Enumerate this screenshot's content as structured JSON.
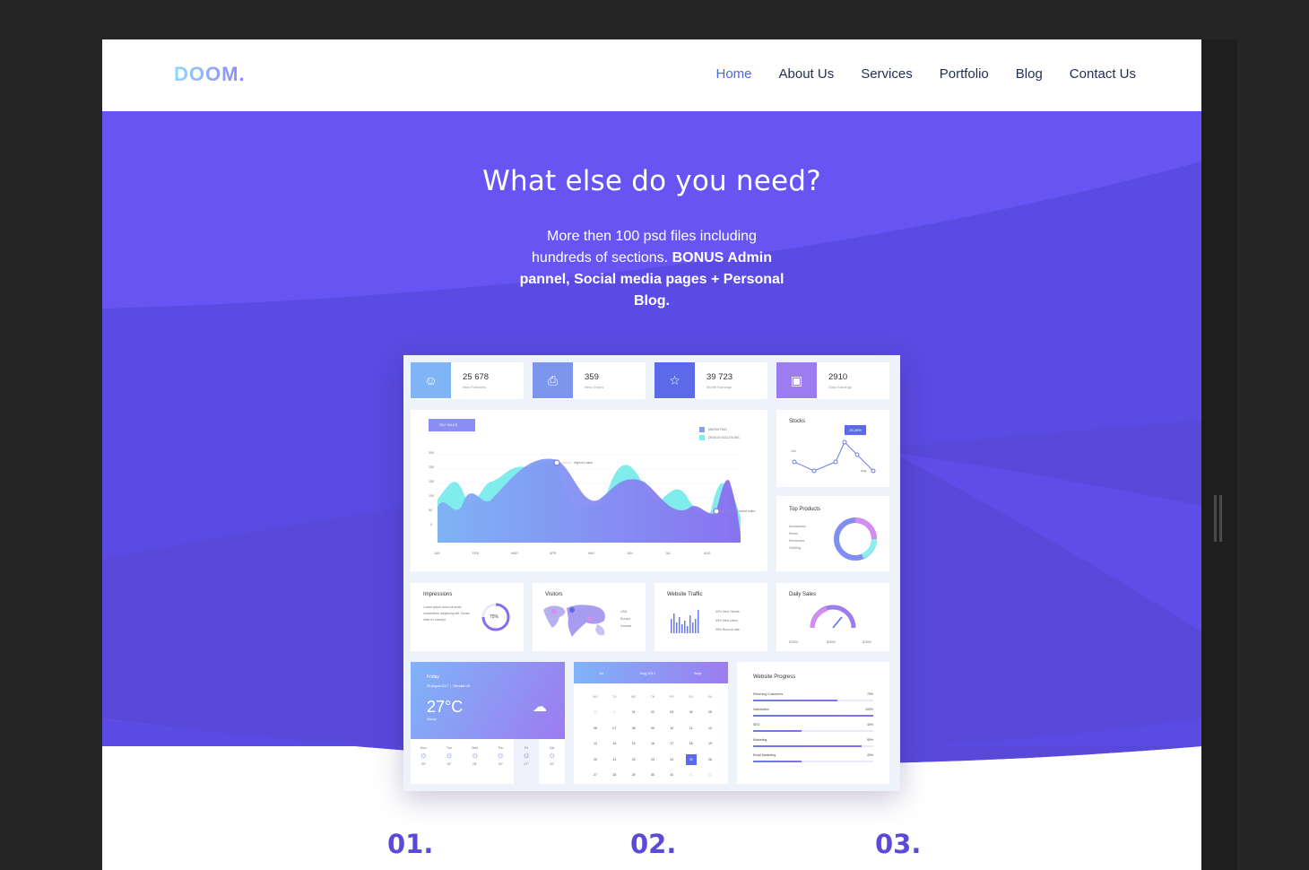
{
  "header": {
    "logo": "DOOM.",
    "nav": [
      {
        "label": "Home",
        "active": true
      },
      {
        "label": "About Us",
        "active": false
      },
      {
        "label": "Services",
        "active": false
      },
      {
        "label": "Portfolio",
        "active": false
      },
      {
        "label": "Blog",
        "active": false
      },
      {
        "label": "Contact Us",
        "active": false
      }
    ]
  },
  "hero": {
    "title": "What else do you need?",
    "subtitle_plain": "More then 100 psd files including hundreds of sections. ",
    "subtitle_bold": "BONUS Admin pannel, Social media pages + Personal Blog."
  },
  "dashboard": {
    "stats": [
      {
        "value": "25 678",
        "label": "New Followers",
        "color": "#7fb4f7"
      },
      {
        "value": "359",
        "label": "New Orders",
        "color": "#7c96ee"
      },
      {
        "value": "39 723",
        "label": "Month Earnings",
        "color": "#5b6ae9"
      },
      {
        "value": "2910",
        "label": "Daily Earnings",
        "color": "#9d7bf0"
      }
    ],
    "sales_tag": "2017 SALES",
    "legend": [
      "MARKETING",
      "DESIGN SOLUTIONS"
    ],
    "y_ticks": [
      "300",
      "250",
      "150",
      "100",
      "50",
      "0"
    ],
    "x_ticks": [
      "JAN",
      "FEB",
      "MAR",
      "APR",
      "MAY",
      "JUN",
      "JUL",
      "AUG"
    ],
    "highest_label": "Highest sales",
    "lowest_label": "Lowest sales",
    "stocks": {
      "title": "Stocks",
      "badge": "25,28%",
      "start": "Jun",
      "end": "Aug"
    },
    "top_products": {
      "title": "Top Products",
      "items": [
        "Accessories",
        "Shoes",
        "Electronics",
        "Clothing"
      ]
    },
    "impressions": {
      "title": "Impressions",
      "text": "Lorem ipsum dolor sit amet, consectetur adipiscing elit. Donec ultric ex suscipit",
      "percent": "75%"
    },
    "visitors": {
      "title": "Visitors",
      "items": [
        "USA",
        "Europe",
        "Canada"
      ]
    },
    "traffic": {
      "title": "Website Traffic",
      "items": [
        "42% New Clients",
        "59% New Users",
        "25% Bounce rate"
      ]
    },
    "daily_sales": {
      "title": "Daily Sales",
      "items": [
        "$1500",
        "$2500",
        "$1500"
      ]
    },
    "weather": {
      "day": "Friday",
      "date": "25 August 2017",
      "place": "Gibraltar UK",
      "temp": "27°C",
      "cond": "Cloudy",
      "days": [
        "Mon",
        "Tue",
        "Wed",
        "Thu",
        "Fri",
        "Sat"
      ],
      "temps": [
        "29°",
        "29°",
        "28°",
        "29°",
        "27°",
        "29°"
      ]
    },
    "calendar": {
      "prev": "Jul",
      "month": "Aug 2017",
      "next": "Sept",
      "weekdays": [
        "MO",
        "TU",
        "WE",
        "TH",
        "FR",
        "SU",
        "SA"
      ],
      "rows": [
        [
          "30",
          "31",
          "01",
          "02",
          "03",
          "04",
          "05"
        ],
        [
          "06",
          "07",
          "08",
          "09",
          "10",
          "11",
          "12"
        ],
        [
          "13",
          "14",
          "15",
          "16",
          "17",
          "18",
          "19"
        ],
        [
          "20",
          "21",
          "22",
          "23",
          "24",
          "25",
          "26"
        ],
        [
          "27",
          "28",
          "29",
          "30",
          "31",
          "01",
          "02"
        ]
      ],
      "selected": "25"
    },
    "progress": {
      "title": "Website Progress",
      "items": [
        {
          "label": "Returning Customers",
          "pct": "70%",
          "value": 0.7
        },
        {
          "label": "Satisfaction",
          "pct": "100%",
          "value": 1.0
        },
        {
          "label": "SEO",
          "pct": "40%",
          "value": 0.4
        },
        {
          "label": "Marketing",
          "pct": "90%",
          "value": 0.9
        },
        {
          "label": "Email Marketing",
          "pct": "40%",
          "value": 0.4
        }
      ]
    }
  },
  "steps": [
    "01.",
    "02.",
    "03."
  ]
}
